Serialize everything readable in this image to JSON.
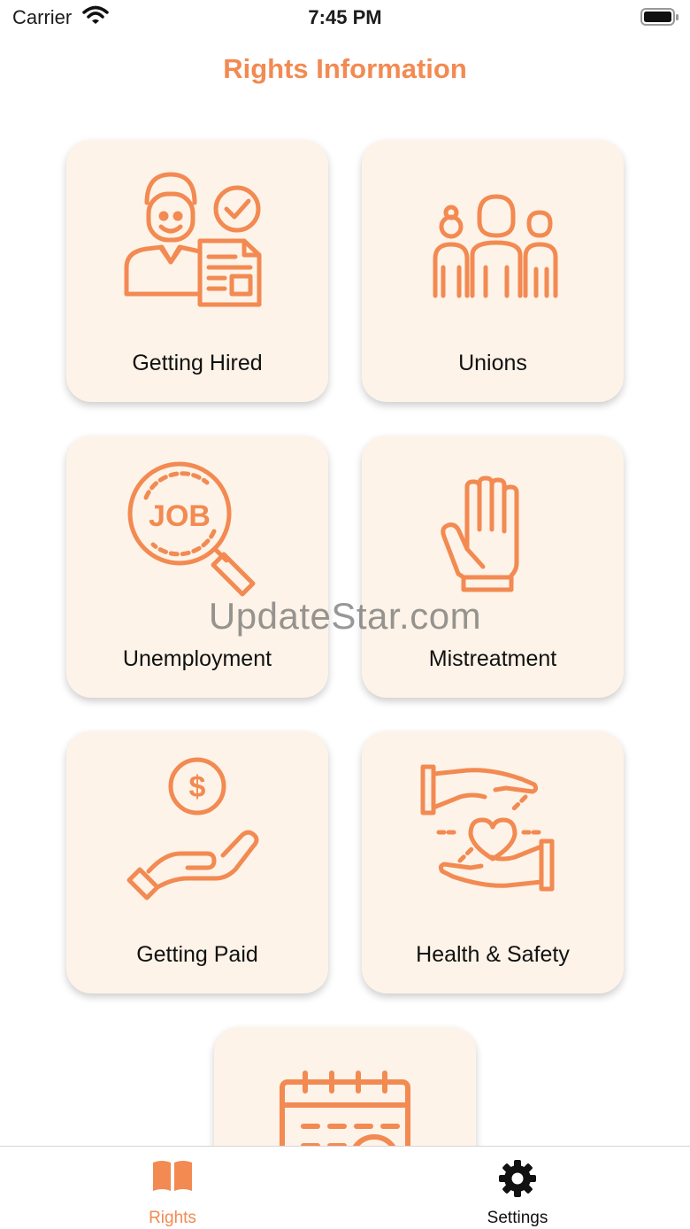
{
  "status_bar": {
    "carrier": "Carrier",
    "time": "7:45 PM"
  },
  "header": {
    "title": "Rights Information"
  },
  "categories": [
    {
      "label": "Getting Hired",
      "icon": "hired-person-document-icon"
    },
    {
      "label": "Unions",
      "icon": "group-of-people-icon"
    },
    {
      "label": "Unemployment",
      "icon": "job-search-magnifier-icon"
    },
    {
      "label": "Mistreatment",
      "icon": "raised-hand-stop-icon"
    },
    {
      "label": "Getting Paid",
      "icon": "hand-with-coin-icon"
    },
    {
      "label": "Health & Safety",
      "icon": "hands-with-heart-icon"
    },
    {
      "label": "",
      "icon": "calendar-icon"
    }
  ],
  "watermark": "UpdateStar.com",
  "tab_bar": {
    "tabs": [
      {
        "label": "Rights",
        "icon": "open-book-icon",
        "active": true
      },
      {
        "label": "Settings",
        "icon": "gear-icon",
        "active": false
      }
    ]
  },
  "colors": {
    "accent": "#f28a52",
    "card_bg": "#fdf3e8",
    "text": "#111111"
  }
}
